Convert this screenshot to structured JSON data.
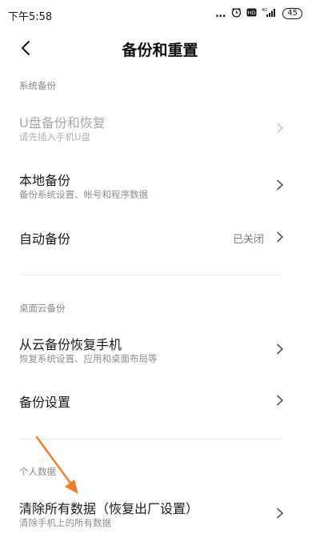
{
  "status_bar": {
    "time": "下午5:58",
    "signal_label": "4G",
    "battery": "45"
  },
  "header": {
    "title": "备份和重置"
  },
  "sections": {
    "system_backup": {
      "label": "系统备份",
      "items": [
        {
          "title": "U盘备份和恢复",
          "subtitle": "请先插入手机U盘"
        },
        {
          "title": "本地备份",
          "subtitle": "备份系统设置、帐号和程序数据"
        },
        {
          "title": "自动备份",
          "value": "已关闭"
        }
      ]
    },
    "cloud_backup": {
      "label": "桌面云备份",
      "items": [
        {
          "title": "从云备份恢复手机",
          "subtitle": "恢复系统设置、应用和桌面布局等"
        },
        {
          "title": "备份设置"
        }
      ]
    },
    "personal_data": {
      "label": "个人数据",
      "items": [
        {
          "title": "清除所有数据（恢复出厂设置）",
          "subtitle": "清除手机上的所有数据"
        }
      ]
    }
  },
  "colors": {
    "annotation_arrow": "#ef7d2a",
    "disabled_text": "#a8a8a8",
    "secondary_text": "#8e8e8e"
  }
}
